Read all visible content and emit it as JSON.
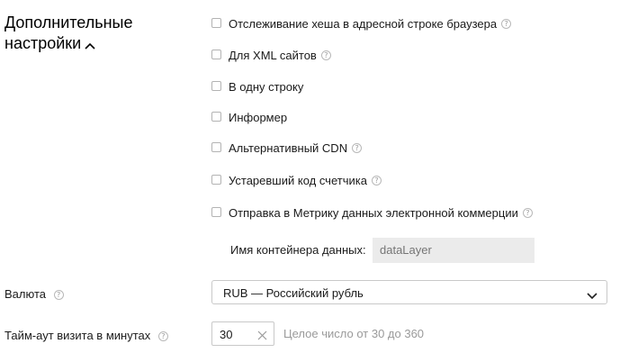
{
  "section": {
    "title_line1": "Дополнительные",
    "title_line2": "настройки"
  },
  "options": [
    {
      "label": "Отслеживание хеша в адресной строке браузера",
      "checked": false,
      "help": true
    },
    {
      "label": "Для XML сайтов",
      "checked": false,
      "help": true
    },
    {
      "label": "В одну строку",
      "checked": false,
      "help": false
    },
    {
      "label": "Информер",
      "checked": false,
      "help": false
    },
    {
      "label": "Альтернативный CDN",
      "checked": false,
      "help": true
    },
    {
      "label": "Устаревший код счетчика",
      "checked": false,
      "help": true
    },
    {
      "label": "Отправка в Метрику данных электронной коммерции",
      "checked": false,
      "help": true
    }
  ],
  "ecommerce": {
    "container_label": "Имя контейнера данных:",
    "container_placeholder": "dataLayer"
  },
  "currency": {
    "label": "Валюта",
    "value": "RUB — Российский рубль"
  },
  "timeout": {
    "label": "Тайм-аут визита в минутах",
    "value": "30",
    "hint": "Целое число от 30 до 360"
  },
  "icons": {
    "help": "?"
  }
}
